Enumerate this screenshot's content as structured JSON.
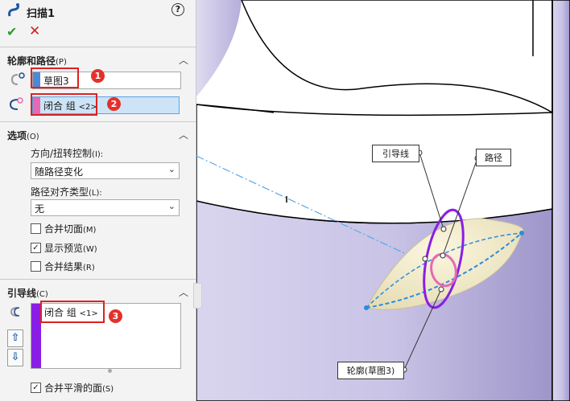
{
  "header": {
    "title": "扫描1",
    "help_glyph": "?",
    "ok_glyph": "✔",
    "cancel_glyph": "✕"
  },
  "profile_path": {
    "heading": "轮廓和路径",
    "heading_key": "(P)",
    "profile_value": "草图3",
    "path_value": "闭合 组",
    "path_suffix": "<2>",
    "badges": [
      "1",
      "2"
    ]
  },
  "options": {
    "heading": "选项",
    "heading_key": "(O)",
    "orient_label": "方向/扭转控制",
    "orient_key": "(I):",
    "orient_value": "随路径变化",
    "align_label": "路径对齐类型",
    "align_key": "(L):",
    "align_value": "无",
    "checkboxes": [
      {
        "label": "合并切面",
        "key": "(M)",
        "checked": false
      },
      {
        "label": "显示预览",
        "key": "(W)",
        "checked": true
      },
      {
        "label": "合并结果",
        "key": "(R)",
        "checked": false
      }
    ]
  },
  "guides": {
    "heading": "引导线",
    "heading_key": "(C)",
    "value": "闭合 组",
    "value_suffix": "<1>",
    "badge": "3",
    "merge_label": "合并平滑的面",
    "merge_key": "(S)",
    "merge_checked": true
  },
  "viewport": {
    "callouts": {
      "guide": "引导线",
      "path": "路径",
      "profile": "轮廓(草图3)"
    }
  },
  "colors": {
    "accent_red": "#e3312b",
    "guide_purple": "#8a1ee6",
    "profile_pink": "#e46ab4",
    "path_blue": "#2b8be0"
  }
}
